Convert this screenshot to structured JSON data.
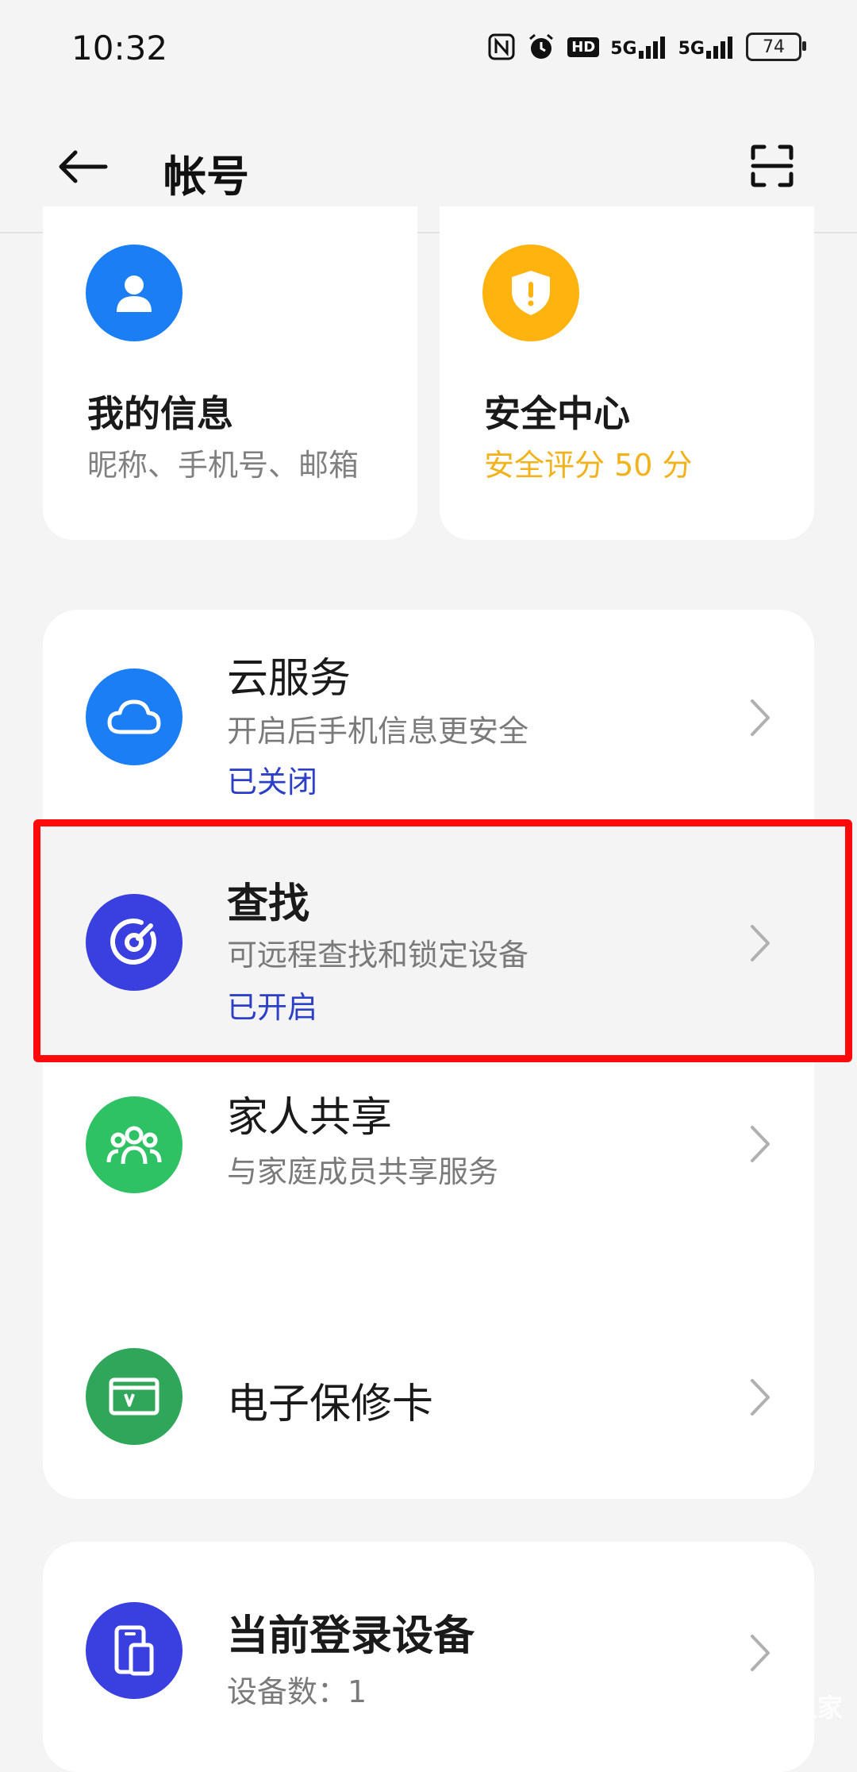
{
  "status_bar": {
    "time": "10:32",
    "icons": [
      "nfc-icon",
      "alarm-icon",
      "hd-icon",
      "signal-5g-icon",
      "signal-5g-icon"
    ],
    "hd_label": "HD",
    "net1": "5G",
    "net2": "5G",
    "battery": "74"
  },
  "header": {
    "title": "帐号"
  },
  "cards": {
    "info": {
      "title": "我的信息",
      "sub": "昵称、手机号、邮箱"
    },
    "security": {
      "title": "安全中心",
      "score": "安全评分 50 分"
    }
  },
  "rows": {
    "cloud": {
      "title": "云服务",
      "desc": "开启后手机信息更安全",
      "status": "已关闭"
    },
    "find": {
      "title": "查找",
      "desc": "可远程查找和锁定设备",
      "status": "已开启"
    },
    "family": {
      "title": "家人共享",
      "desc": "与家庭成员共享服务"
    },
    "warranty": {
      "title": "电子保修卡"
    },
    "devices": {
      "title": "当前登录设备",
      "desc": "设备数：1"
    }
  },
  "watermark": {
    "text": "OPPO之家"
  },
  "colors": {
    "blue": "#1c7ef5",
    "yellow": "#ffb30f",
    "indigo": "#3a3fe0",
    "green_light": "#2ec264",
    "green_dark": "#2fa65a",
    "status_blue": "#2c3fc6",
    "highlight_red": "#ff0a0a"
  }
}
